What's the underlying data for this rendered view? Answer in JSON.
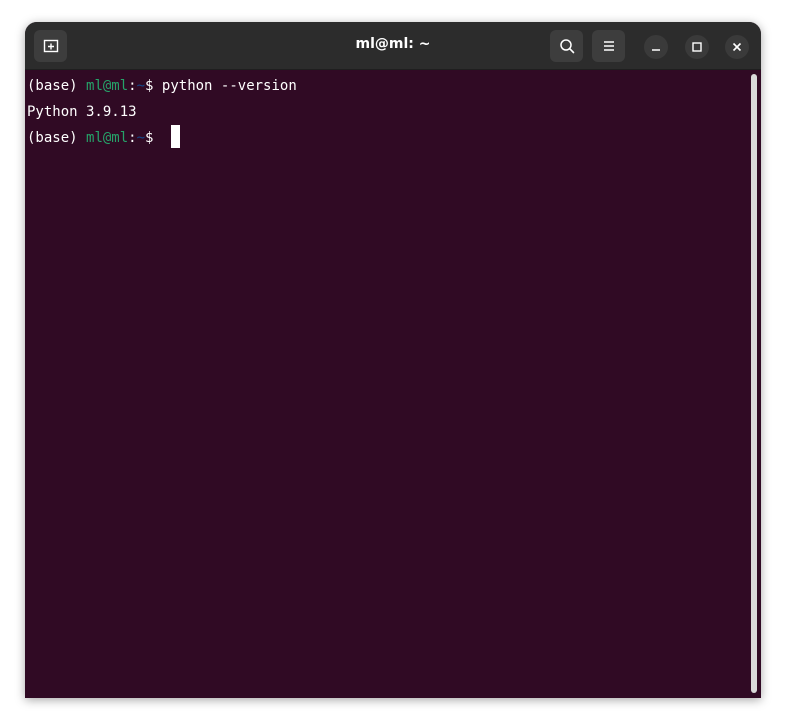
{
  "window": {
    "title": "ml@ml: ~"
  },
  "colors": {
    "terminal_background": "#300a24",
    "titlebar_background": "#2c2c2c",
    "prompt_user_host": "#26a269",
    "prompt_path": "#12488b",
    "text": "#ffffff"
  },
  "header": {
    "icons": {
      "new_tab": "new-tab-icon",
      "search": "search-icon",
      "menu": "hamburger-menu-icon",
      "minimize": "minimize-icon",
      "maximize": "maximize-icon",
      "close": "close-icon"
    }
  },
  "terminal": {
    "line1": {
      "env": "(base) ",
      "user_host": "ml@ml",
      "colon": ":",
      "path": "~",
      "dollar": "$ ",
      "command": "python --version"
    },
    "line2": {
      "output": "Python 3.9.13"
    },
    "line3": {
      "env": "(base) ",
      "user_host": "ml@ml",
      "colon": ":",
      "path": "~",
      "dollar": "$ ",
      "command": ""
    }
  }
}
